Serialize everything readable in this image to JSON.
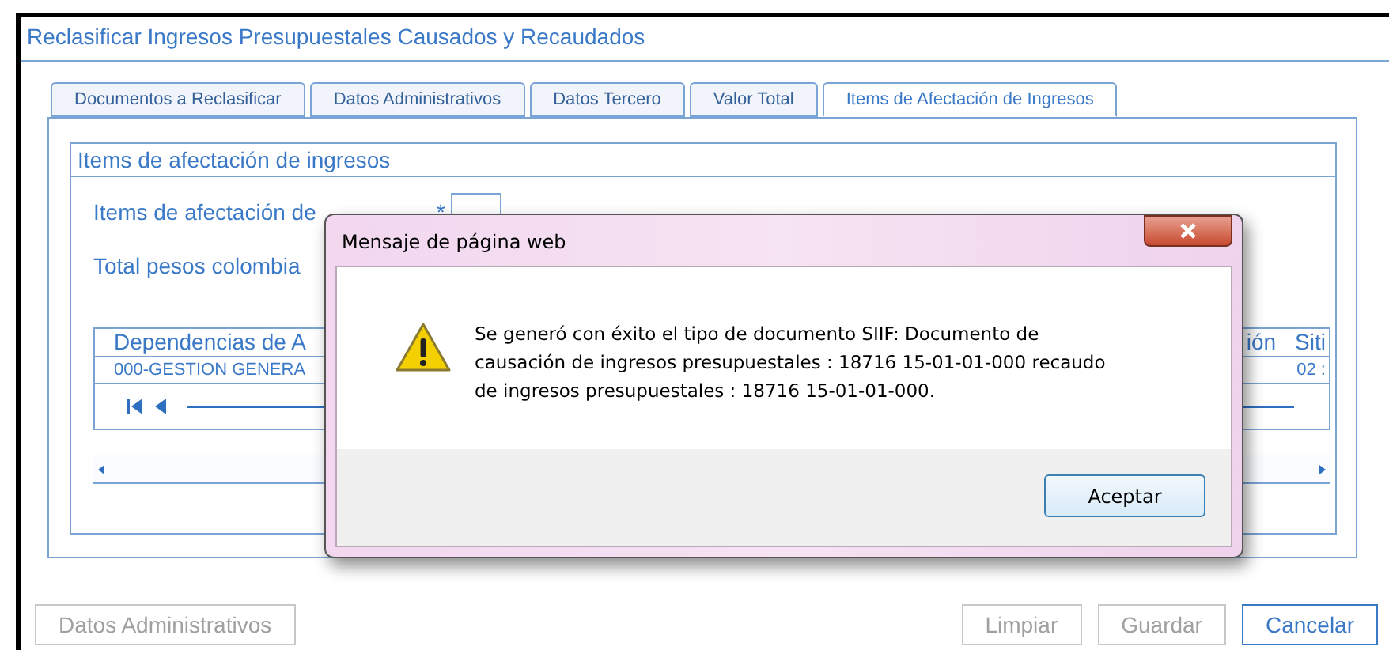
{
  "window": {
    "title": "Reclasificar Ingresos Presupuestales Causados y Recaudados"
  },
  "tabs": [
    {
      "label": "Documentos a Reclasificar",
      "selected": false
    },
    {
      "label": "Datos Administrativos",
      "selected": false
    },
    {
      "label": "Datos Tercero",
      "selected": false
    },
    {
      "label": "Valor Total",
      "selected": false
    },
    {
      "label": "Items de Afectación de Ingresos",
      "selected": true
    }
  ],
  "section": {
    "title": "Items de afectación de ingresos",
    "field_label": "Items de afectación de",
    "required_mark": "*",
    "total_label": "Total pesos colombia"
  },
  "table": {
    "columns": [
      "Dependencias de A",
      "ión",
      "Siti"
    ],
    "rows": [
      [
        "000-GESTION GENERA",
        "",
        "02 :"
      ]
    ]
  },
  "buttons": [
    {
      "label": "Datos Administrativos",
      "disabled": true
    },
    {
      "label": "Limpiar",
      "disabled": true
    },
    {
      "label": "Guardar",
      "disabled": true
    },
    {
      "label": "Cancelar",
      "disabled": false
    }
  ],
  "dialog": {
    "title": "Mensaje de página web",
    "message": "Se generó con éxito el tipo de documento SIIF: Documento de causación de ingresos presupuestales : 18716 15-01-01-000 recaudo de ingresos presupuestales : 18716 15-01-01-000.",
    "button": "Aceptar"
  }
}
